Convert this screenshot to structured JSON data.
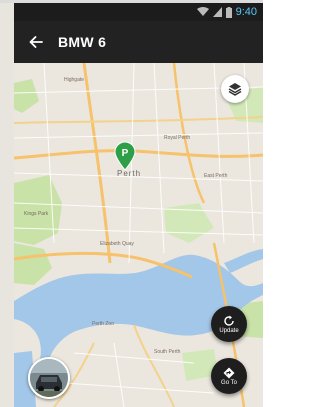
{
  "status_bar": {
    "time": "9:40"
  },
  "app_bar": {
    "title": "BMW 6"
  },
  "map": {
    "city_label": "Perth",
    "pin_letter": "P",
    "place_labels": [
      "Royal Perth",
      "Perth Zoo",
      "Elizabeth Quay",
      "South Perth",
      "Kings Park",
      "Highgate",
      "East Perth"
    ]
  },
  "buttons": {
    "update": "Update",
    "goto": "Go To"
  },
  "icons": {
    "back": "arrow-left-icon",
    "layers": "layers-icon",
    "refresh": "refresh-icon",
    "navigate": "navigate-icon"
  },
  "colors": {
    "water": "#a3c7e8",
    "park": "#c8e2a8",
    "pin": "#2e9e47",
    "status_time": "#5ac8fa"
  }
}
